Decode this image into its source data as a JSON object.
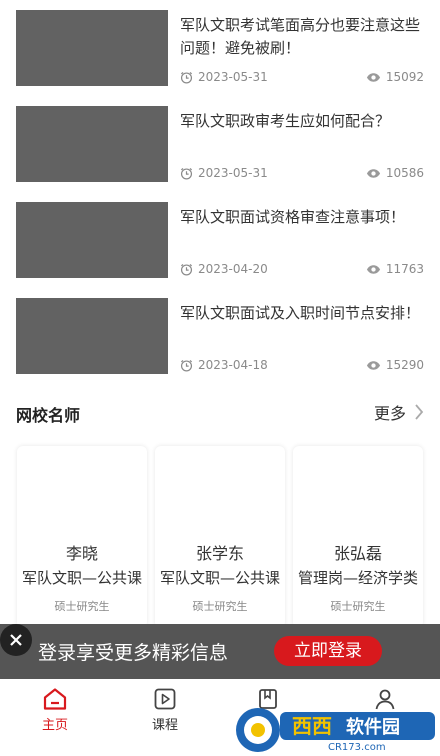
{
  "articles": [
    {
      "title": "军队文职考试笔面高分也要注意这些问题！避免被刷！",
      "date": "2023-05-31",
      "views": "15092"
    },
    {
      "title": "军队文职政审考生应如何配合？",
      "date": "2023-05-31",
      "views": "10586"
    },
    {
      "title": "军队文职面试资格审查注意事项！",
      "date": "2023-04-20",
      "views": "11763"
    },
    {
      "title": "军队文职面试及入职时间节点安排！",
      "date": "2023-04-18",
      "views": "15290"
    }
  ],
  "teachers_section": {
    "title": "网校名师",
    "more_label": "更多"
  },
  "teachers": [
    {
      "name": "李晓",
      "course": "军队文职—公共课",
      "degree": "硕士研究生"
    },
    {
      "name": "张学东",
      "course": "军队文职—公共课",
      "degree": "硕士研究生"
    },
    {
      "name": "张弘磊",
      "course": "管理岗—经济学类",
      "degree": "硕士研究生"
    }
  ],
  "login_banner": {
    "text": "登录享受更多精彩信息",
    "button_label": "立即登录"
  },
  "tabbar": {
    "tabs": [
      {
        "label": "主页"
      },
      {
        "label": "课程"
      }
    ]
  },
  "watermark": {
    "brand": "西西",
    "tag": "软件园",
    "url": "CR173.com"
  },
  "colors": {
    "accent": "#d8191d",
    "thumb": "#626262",
    "banner": "#464646"
  },
  "icons": {
    "date": "clock-icon",
    "views": "eye-icon",
    "more": "chevron-right-icon",
    "close": "close-icon"
  }
}
